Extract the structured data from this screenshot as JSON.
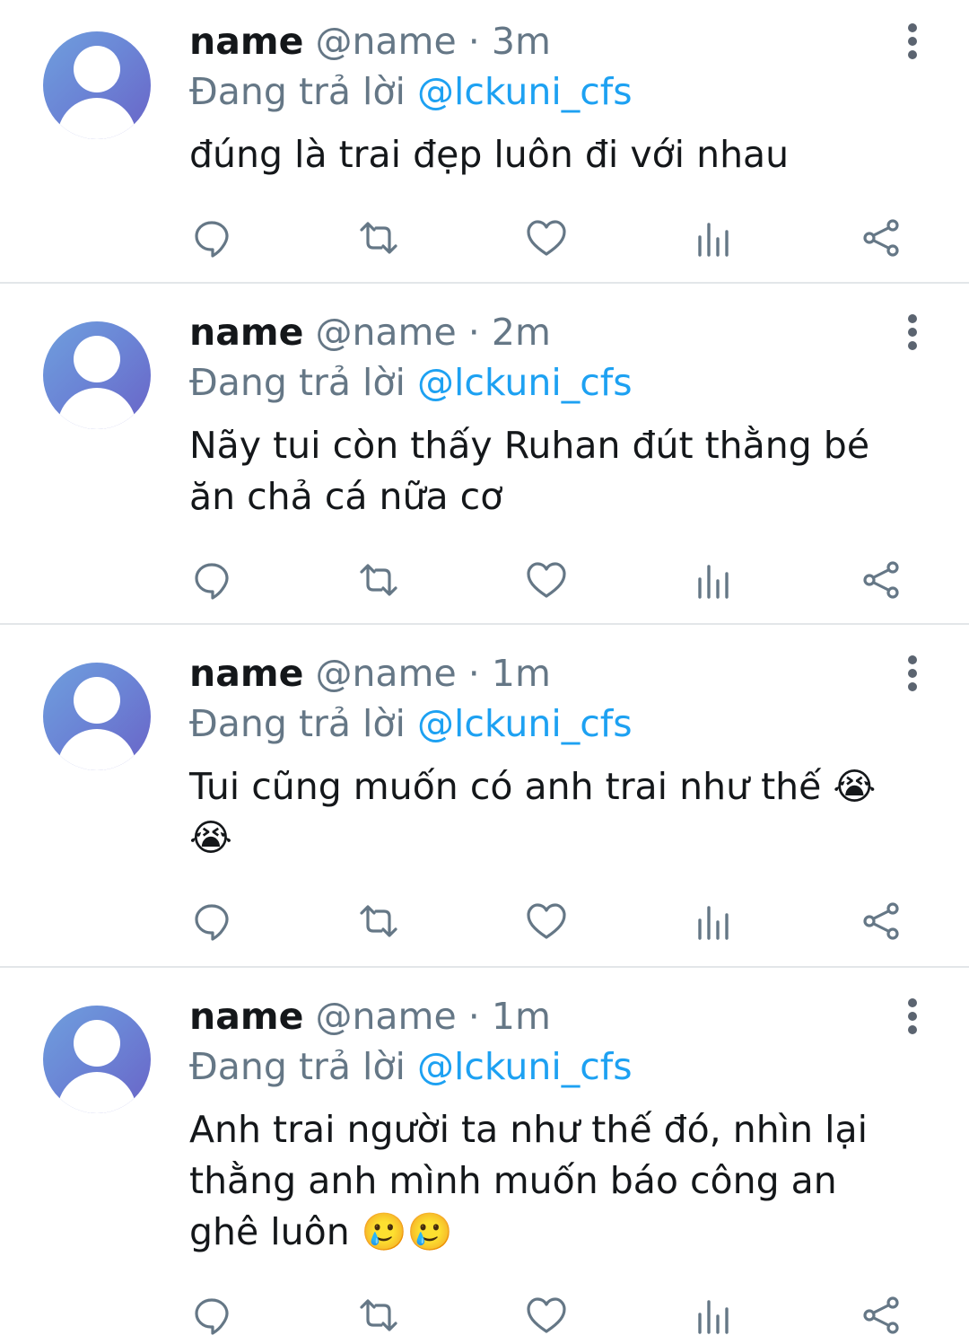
{
  "tweets": [
    {
      "name": "name",
      "handle": "@name",
      "separator": "·",
      "time": "3m",
      "reply_prefix": "Đang trả lời",
      "reply_to": "@lckuni_cfs",
      "text_lines": [
        "đúng là trai đẹp luôn đi với nhau"
      ]
    },
    {
      "name": "name",
      "handle": "@name",
      "separator": "·",
      "time": "2m",
      "reply_prefix": "Đang trả lời",
      "reply_to": "@lckuni_cfs",
      "text_lines": [
        "Nãy tui còn thấy Ruhan đút thằng bé",
        "ăn chả cá nữa cơ"
      ]
    },
    {
      "name": "name",
      "handle": "@name",
      "separator": "·",
      "time": "1m",
      "reply_prefix": "Đang trả lời",
      "reply_to": "@lckuni_cfs",
      "text_lines": [
        "Tui cũng muốn có anh trai như thế 😭",
        "😭"
      ]
    },
    {
      "name": "name",
      "handle": "@name",
      "separator": "·",
      "time": "1m",
      "reply_prefix": "Đang trả lời",
      "reply_to": "@lckuni_cfs",
      "text_lines": [
        "Anh trai người ta như thế đó, nhìn lại",
        "thằng anh mình muốn báo công an",
        "ghê luôn 🥲🥲"
      ]
    }
  ],
  "action_icons": [
    "reply-icon",
    "retweet-icon",
    "like-icon",
    "analytics-icon",
    "share-icon"
  ],
  "colors": {
    "primary_text": "#14171a",
    "secondary_text": "#657786",
    "mention": "#1da1f2",
    "divider": "#e3e6e9",
    "icon": "#657786"
  }
}
